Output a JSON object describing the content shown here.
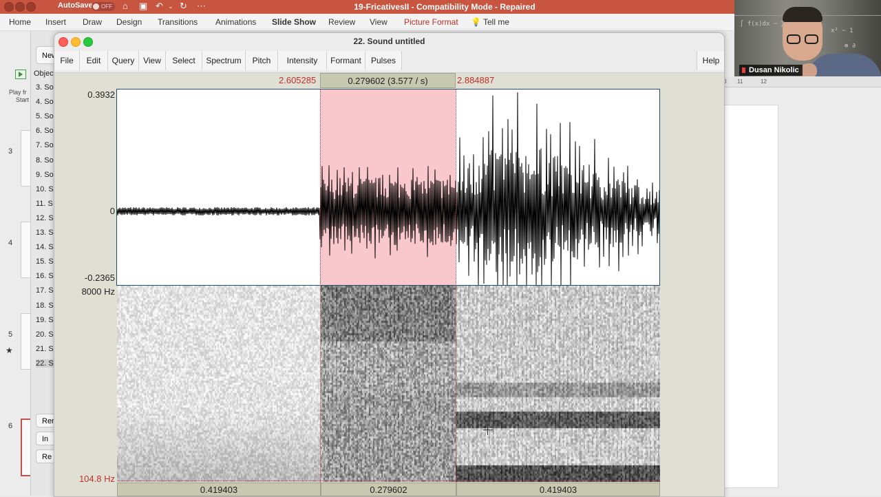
{
  "ppt": {
    "autosave_label": "AutoSave",
    "autosave_state": "OFF",
    "doc_title": "19-FricativesII  -  Compatibility Mode  -  Repaired",
    "ribbon_tabs": [
      "Home",
      "Insert",
      "Draw",
      "Design",
      "Transitions",
      "Animations",
      "Slide Show",
      "Review",
      "View",
      "Picture Format",
      "Tell me"
    ],
    "play_label_1": "Play fr",
    "play_label_2": "Start",
    "slide_numbers": [
      "3",
      "4",
      "5",
      "6"
    ],
    "ruler_labels": [
      "0",
      "11",
      "12"
    ]
  },
  "objects_window": {
    "new_button": "New",
    "header": "Objec",
    "items": [
      "3. So",
      "4. So",
      "5. So",
      "6. So",
      "7. So",
      "8. So",
      "9. So",
      "10. S",
      "11. S",
      "12. S",
      "13. S",
      "14. S",
      "15. S",
      "16. S",
      "17. S",
      "18. S",
      "19. S",
      "20. S",
      "21. S",
      "22. S"
    ],
    "buttons": [
      "Ren",
      "In",
      "Re"
    ]
  },
  "webcam": {
    "name": "Dusan Nikolic"
  },
  "praat": {
    "window_title": "22. Sound untitled",
    "menus": [
      "File",
      "Edit",
      "Query",
      "View",
      "Select",
      "Spectrum",
      "Pitch",
      "Intensity",
      "Formant",
      "Pulses"
    ],
    "help": "Help",
    "selection_start": "2.605285",
    "selection_end": "2.884887",
    "selection_duration": "0.279602 (3.577 / s)",
    "amp_max": "0.3932",
    "amp_zero": "0",
    "amp_min": "-0.2365",
    "freq_max": "8000 Hz",
    "freq_min": "104.8 Hz",
    "bottom_segments": [
      "0.419403",
      "0.279602",
      "0.419403"
    ],
    "selection_color": "#f8c8cc"
  }
}
